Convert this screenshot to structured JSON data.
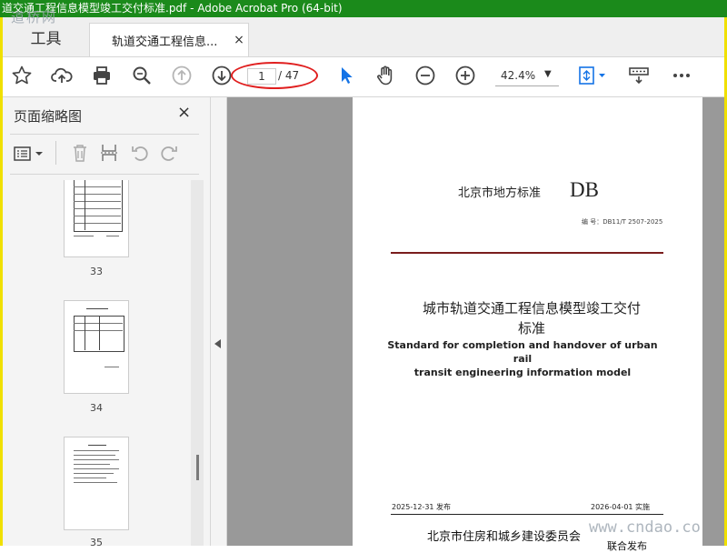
{
  "window": {
    "title": "道交通工程信息模型竣工交付标准.pdf - Adobe Acrobat Pro (64-bit)"
  },
  "watermark_top": "道桥网",
  "watermark_bottom": "www.cndao.co",
  "tabs": {
    "tools_label": "工具",
    "doc_label": "轨道交通工程信息...",
    "doc_close": "×"
  },
  "toolbar": {
    "icons": [
      "star-icon",
      "upload-icon",
      "print-icon",
      "search-icon",
      "page-up-icon",
      "page-down-icon",
      "pointer-icon",
      "hand-icon",
      "zoom-out-icon",
      "zoom-in-icon",
      "fit-page-icon",
      "keyboard-icon",
      "more-icon"
    ],
    "page_current": "1",
    "page_total": "/ 47",
    "zoom_value": "42.4%",
    "zoom_caret": "▼"
  },
  "sidebar": {
    "title": "页面缩略图",
    "close": "×",
    "thumbnails": [
      {
        "page_label": "33"
      },
      {
        "page_label": "34"
      },
      {
        "page_label": "35"
      }
    ]
  },
  "document_page": {
    "issuer": "北京市地方标准",
    "standard_mark": "DB",
    "standard_code": "编  号：DB11/T 2507-2025",
    "title_cn_line1": "城市轨道交通工程信息模型竣工交付",
    "title_cn_line2": "标准",
    "title_en_line1": "Standard for completion and handover of urban rail",
    "title_en_line2": "transit engineering information model",
    "publish_date": "2025-12-31 发布",
    "implement_date": "2026-04-01 实施",
    "authority": "北京市住房和城乡建设委员会",
    "authority_suffix": "联合发布"
  },
  "colors": {
    "titlebar": "#1b8a1b",
    "frame": "#f0e000",
    "annotation_circle": "#e01e1e",
    "accent_blue": "#1473e6",
    "rule": "#7a1d1d"
  }
}
